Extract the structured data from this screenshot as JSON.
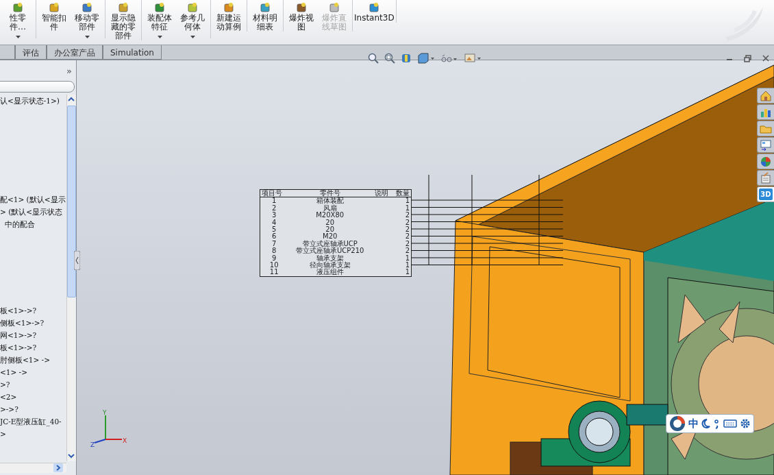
{
  "toolbar": {
    "groups": [
      [
        {
          "label": "性零件…",
          "dropdown": true,
          "disabled": false
        }
      ],
      [
        {
          "label": "智能扣件",
          "dropdown": false,
          "disabled": false
        },
        {
          "label": "移动零部件",
          "dropdown": true,
          "disabled": false
        }
      ],
      [
        {
          "label": "显示隐藏的零部件",
          "dropdown": false,
          "disabled": false
        }
      ],
      [
        {
          "label": "装配体特征",
          "dropdown": true,
          "disabled": false
        },
        {
          "label": "参考几何体",
          "dropdown": true,
          "disabled": false
        }
      ],
      [
        {
          "label": "新建运动算例",
          "dropdown": false,
          "disabled": false
        }
      ],
      [
        {
          "label": "材料明细表",
          "dropdown": false,
          "disabled": false
        }
      ],
      [
        {
          "label": "爆炸视图",
          "dropdown": false,
          "disabled": false
        },
        {
          "label": "爆炸直线草图",
          "dropdown": false,
          "disabled": true
        }
      ],
      [
        {
          "label": "Instant3D",
          "dropdown": false,
          "disabled": false
        }
      ]
    ]
  },
  "tabs": [
    {
      "label": "评估",
      "selected": false
    },
    {
      "label": "办公室产品",
      "selected": false
    },
    {
      "label": "Simulation",
      "selected": false
    }
  ],
  "tree": {
    "expand_label": "»",
    "groups": [
      [
        "认<显示状态-1>)"
      ],
      [
        "配<1> (默认<显示",
        "> (默认<显示状态",
        "  中的配合"
      ],
      [
        "板<1>->?",
        "侧板<1>->?",
        "网<1>->?",
        "板<1>->?",
        "肘侧板<1> ->",
        "<1> ->",
        ">?",
        "<2>",
        ">->?",
        "JC-E型液压缸_40-",
        ">"
      ]
    ]
  },
  "bom": {
    "columns": [
      "项目号",
      "零件号",
      "说明",
      "数量"
    ],
    "rows": [
      [
        "1",
        "箱体装配",
        "",
        "1"
      ],
      [
        "2",
        "风扇",
        "",
        "1"
      ],
      [
        "3",
        "M20X80",
        "",
        "2"
      ],
      [
        "4",
        "20",
        "",
        "2"
      ],
      [
        "5",
        "20",
        "",
        "2"
      ],
      [
        "6",
        "M20",
        "",
        "2"
      ],
      [
        "7",
        "带立式座轴承UCP",
        "",
        "2"
      ],
      [
        "8",
        "带立式座轴承UCP210",
        "",
        "2"
      ],
      [
        "9",
        "轴承支架",
        "",
        "1"
      ],
      [
        "10",
        "径向轴承支架",
        "",
        "1"
      ],
      [
        "11",
        "液压组件",
        "",
        "1"
      ]
    ]
  },
  "taskpane": [
    {
      "kind": "home",
      "selected": false
    },
    {
      "kind": "library",
      "selected": false
    },
    {
      "kind": "folder",
      "selected": false
    },
    {
      "kind": "palette",
      "selected": false
    },
    {
      "kind": "appearance",
      "selected": false
    },
    {
      "kind": "properties",
      "selected": false
    },
    {
      "kind": "text",
      "label": "3D",
      "selected": true
    }
  ],
  "triad": [
    "Y",
    "Z",
    "X"
  ],
  "ime": {
    "mode": "中"
  }
}
